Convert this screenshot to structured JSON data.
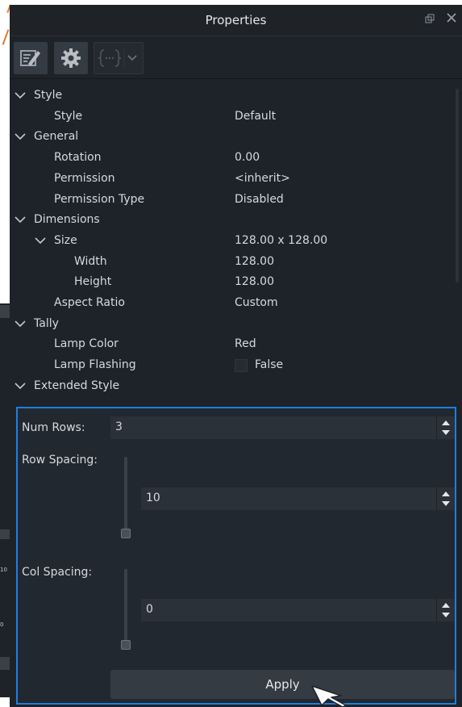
{
  "window": {
    "title": "Properties",
    "float_icon": "float-icon",
    "close_icon": "close-icon"
  },
  "toolbar": {
    "buttons": [
      {
        "name": "edit-properties",
        "icon": "pencil-edit-icon"
      },
      {
        "name": "settings",
        "icon": "gear-icon"
      },
      {
        "name": "script",
        "icon": "script-braces-icon"
      }
    ]
  },
  "tree": {
    "style": {
      "label": "Style",
      "items": [
        {
          "label": "Style",
          "value": "Default"
        }
      ]
    },
    "general": {
      "label": "General",
      "items": [
        {
          "label": "Rotation",
          "value": "0.00"
        },
        {
          "label": "Permission",
          "value": "<inherit>"
        },
        {
          "label": "Permission Type",
          "value": "Disabled"
        }
      ]
    },
    "dimensions": {
      "label": "Dimensions",
      "size": {
        "label": "Size",
        "value": "128.00 x 128.00"
      },
      "items": [
        {
          "label": "Width",
          "value": "128.00"
        },
        {
          "label": "Height",
          "value": "128.00"
        }
      ],
      "aspect": {
        "label": "Aspect Ratio",
        "value": "Custom"
      }
    },
    "tally": {
      "label": "Tally",
      "lamp_color": {
        "label": "Lamp Color",
        "value": "Red"
      },
      "lamp_flashing": {
        "label": "Lamp Flashing",
        "value": "False"
      }
    },
    "extended": {
      "label": "Extended Style"
    }
  },
  "extended_style": {
    "num_rows": {
      "label": "Num Rows:",
      "value": "3"
    },
    "row_spacing": {
      "label": "Row Spacing:",
      "value": "10"
    },
    "col_spacing": {
      "label": "Col Spacing:",
      "value": "0"
    },
    "apply_label": "Apply",
    "accent": "#1e7fe0"
  },
  "background_window": {
    "values": [
      "10",
      "0"
    ]
  }
}
